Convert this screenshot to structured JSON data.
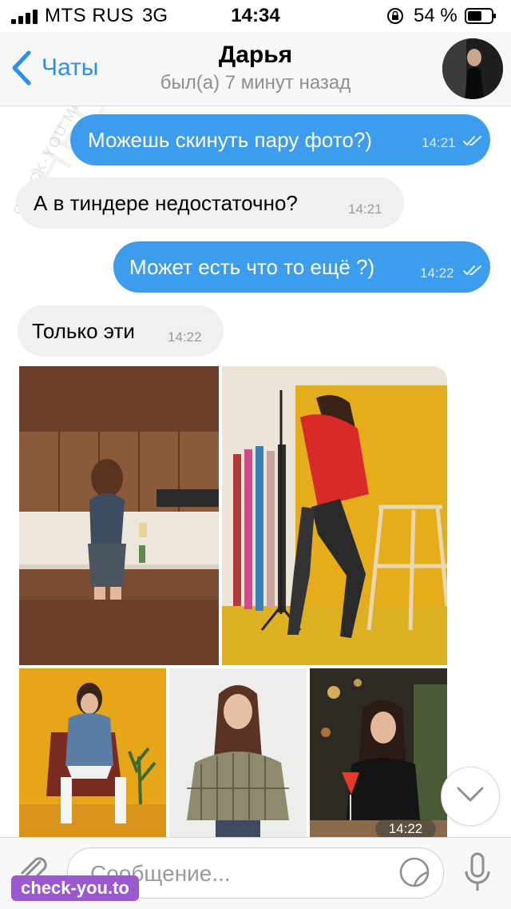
{
  "status_bar": {
    "carrier": "MTS RUS",
    "network": "3G",
    "time": "14:34",
    "battery_percent": "54 %",
    "icons": [
      "signal-icon",
      "orientation-lock-icon",
      "battery-icon"
    ]
  },
  "header": {
    "back_label": "Чаты",
    "title": "Дарья",
    "subtitle": "был(а) 7 минут назад"
  },
  "messages": [
    {
      "direction": "outgoing",
      "text": "Можешь скинуть пару фото?)",
      "time": "14:21",
      "read": true
    },
    {
      "direction": "incoming",
      "text": "А в тиндере недостаточно?",
      "time": "14:21"
    },
    {
      "direction": "outgoing",
      "text": "Может есть что то ещё ?)",
      "time": "14:22",
      "read": true
    },
    {
      "direction": "incoming",
      "text": "Только эти",
      "time": "14:22"
    }
  ],
  "album": {
    "photo_count": 5,
    "time": "14:22"
  },
  "input": {
    "placeholder": "Сообщение..."
  },
  "watermarks": {
    "big": "CHECK YOU ME",
    "small": "CHECK-YOU.ME",
    "badge": "check-you.to"
  },
  "colors": {
    "accent": "#2b8ff0",
    "outgoing_bubble": "#3e9cec",
    "incoming_bubble": "#f0f0f0",
    "photo_backdrop_yellow": "#e9b520"
  }
}
